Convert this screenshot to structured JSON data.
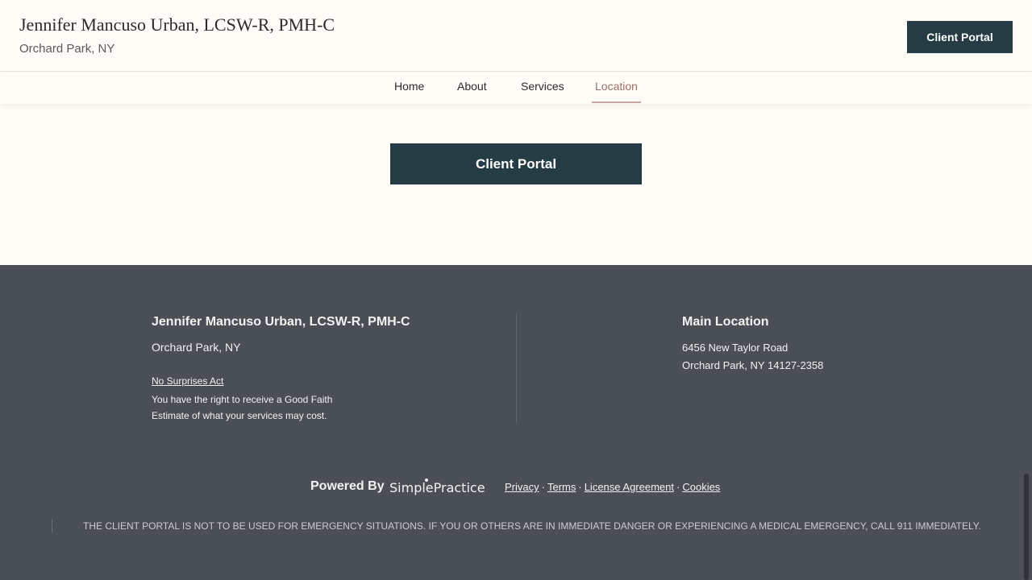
{
  "header": {
    "title": "Jennifer Mancuso Urban, LCSW-R, PMH-C",
    "location": "Orchard Park, NY",
    "portal_label": "Client Portal"
  },
  "nav": {
    "items": [
      {
        "label": "Home"
      },
      {
        "label": "About"
      },
      {
        "label": "Services"
      },
      {
        "label": "Location",
        "active": true
      }
    ]
  },
  "main": {
    "portal_label": "Client Portal"
  },
  "footer": {
    "name": "Jennifer Mancuso Urban, LCSW-R, PMH-C",
    "location": "Orchard Park, NY",
    "nsa_link": "No Surprises Act",
    "nsa_text": "You have the right to receive a Good Faith Estimate of what your services may cost.",
    "main_location_label": "Main Location",
    "address_line1": "6456 New Taylor Road",
    "address_line2": "Orchard Park, NY 14127-2358",
    "powered_by": "Powered By",
    "brand": "SimplePractice",
    "links": [
      "Privacy",
      "Terms",
      "License Agreement",
      "Cookies"
    ],
    "disclaimer": "THE CLIENT PORTAL IS NOT TO BE USED FOR EMERGENCY SITUATIONS. IF YOU OR OTHERS ARE IN IMMEDIATE DANGER OR EXPERIENCING A MEDICAL EMERGENCY, CALL 911 IMMEDIATELY."
  },
  "colors": {
    "background": "#fffcf7",
    "primary_button": "#263c44",
    "footer_bg": "#4a4e55",
    "nav_active": "#9a6e6a"
  }
}
